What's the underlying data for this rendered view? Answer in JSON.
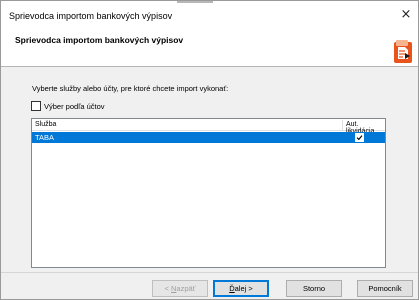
{
  "window": {
    "title": "Sprievodca importom bankových výpisov",
    "close_glyph": "×"
  },
  "header": {
    "title": "Sprievodca importom bankových výpisov",
    "logo_icon": "import-wizard-icon",
    "logo_color": "#e8541c"
  },
  "prompt": "Vyberte služby alebo účty, pre ktoré chcete import vykonať:",
  "filter": {
    "label": "Výber podľa účtov",
    "checked": false
  },
  "list": {
    "columns": [
      "Služba",
      "Aut. likvidácia"
    ],
    "rows": [
      {
        "name": "TABA",
        "auto_liquidation": true,
        "selected": true
      }
    ],
    "selection_color": "#0078d7"
  },
  "buttons": {
    "back": {
      "prefix": "< ",
      "underlined": "N",
      "rest": "azpäť"
    },
    "next": {
      "underlined": "Ď",
      "rest": "alej >"
    },
    "cancel": "Storno",
    "help": "Pomocník"
  }
}
